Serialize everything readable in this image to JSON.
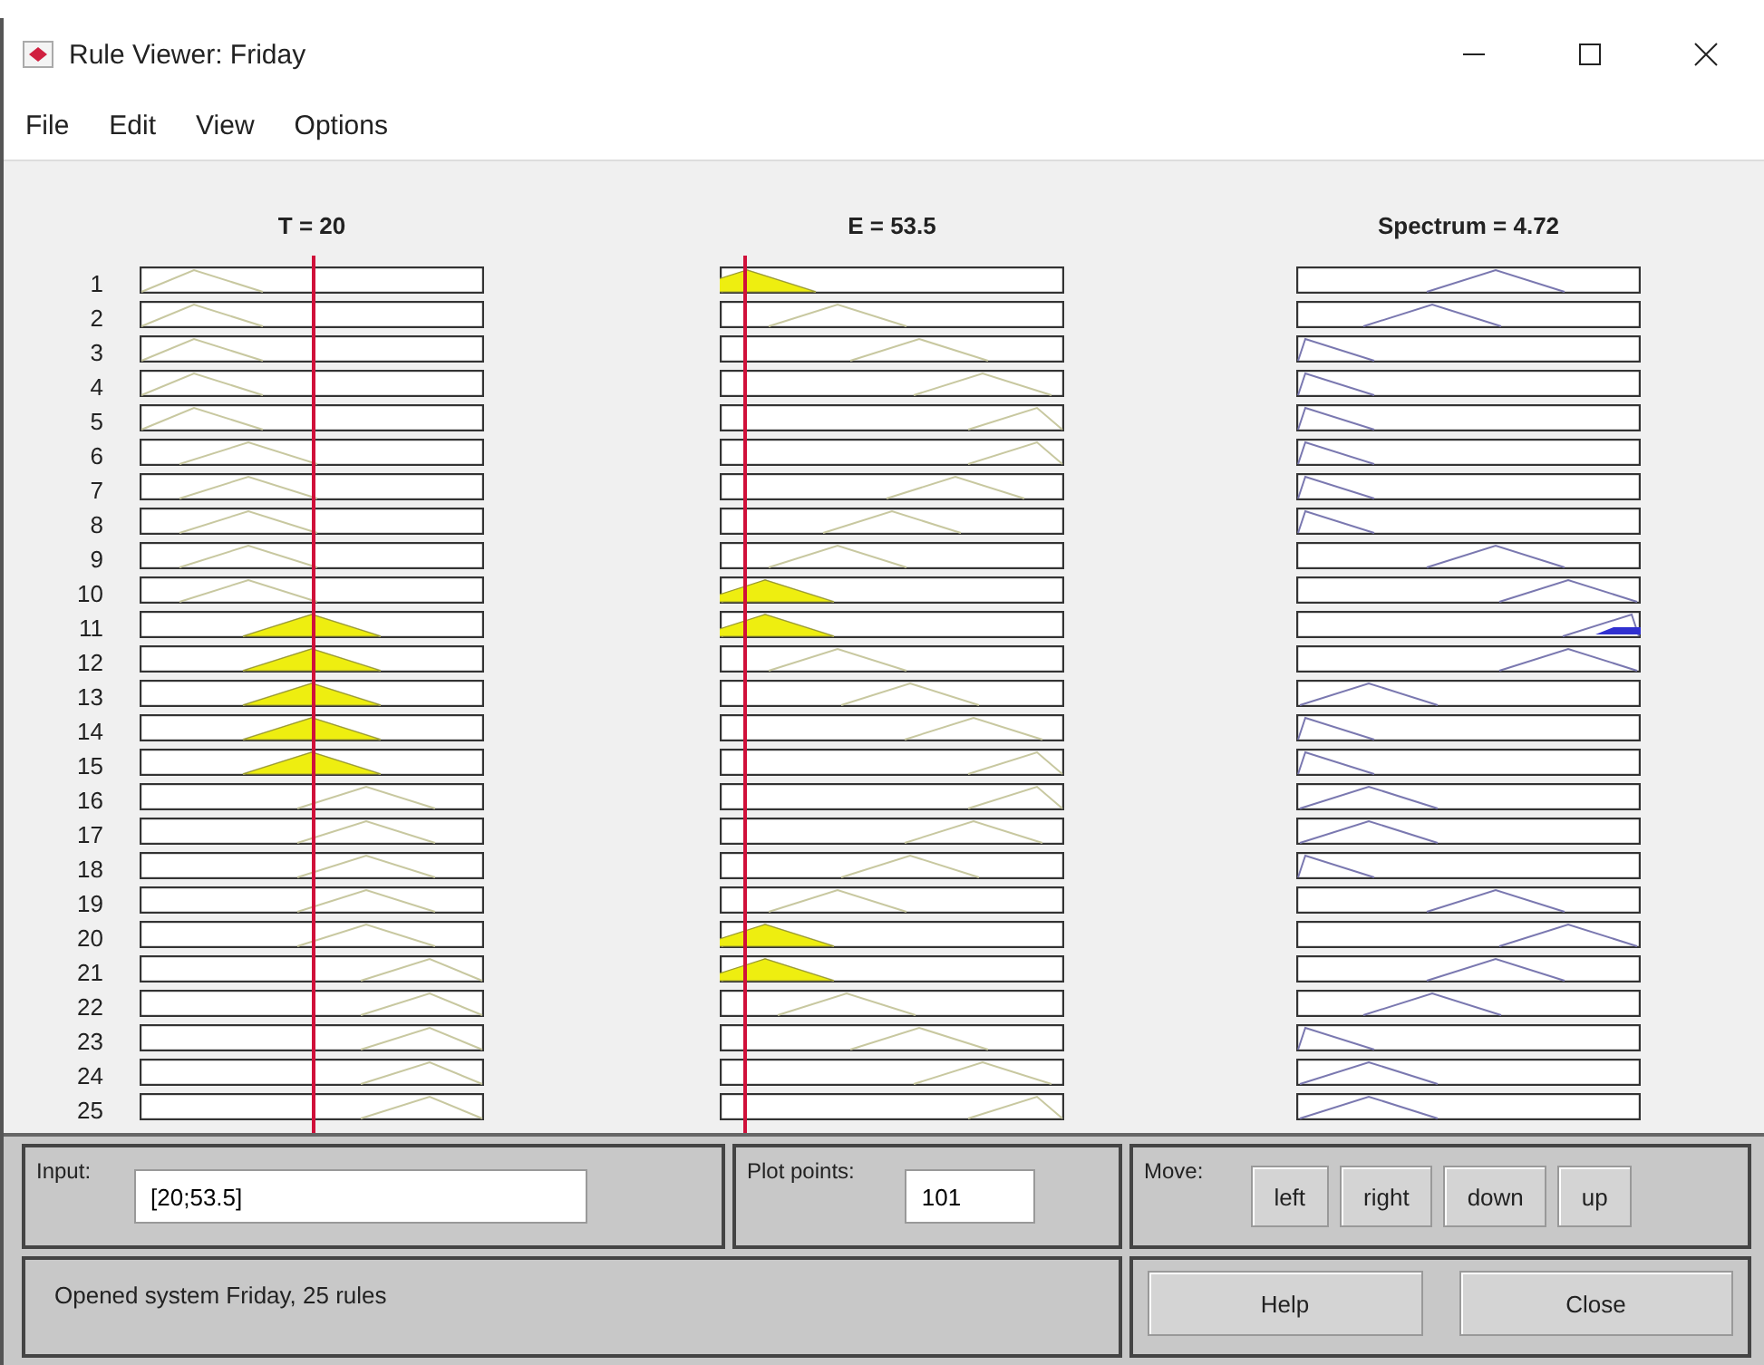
{
  "window": {
    "title": "Rule Viewer: Friday"
  },
  "menu": [
    "File",
    "Edit",
    "View",
    "Options"
  ],
  "variables": [
    {
      "label": "T = 20",
      "kind": "input"
    },
    {
      "label": "E = 53.5",
      "kind": "input"
    },
    {
      "label": "Spectrum = 4.72",
      "kind": "output"
    }
  ],
  "rules": [
    {
      "number": "1",
      "fired": [
        false,
        true,
        false
      ]
    },
    {
      "number": "2",
      "fired": [
        false,
        false,
        false
      ]
    },
    {
      "number": "3",
      "fired": [
        false,
        false,
        false
      ]
    },
    {
      "number": "4",
      "fired": [
        false,
        false,
        false
      ]
    },
    {
      "number": "5",
      "fired": [
        false,
        false,
        false
      ]
    },
    {
      "number": "6",
      "fired": [
        false,
        false,
        false
      ]
    },
    {
      "number": "7",
      "fired": [
        false,
        false,
        false
      ]
    },
    {
      "number": "8",
      "fired": [
        false,
        false,
        false
      ]
    },
    {
      "number": "9",
      "fired": [
        false,
        false,
        false
      ]
    },
    {
      "number": "10",
      "fired": [
        false,
        true,
        false
      ]
    },
    {
      "number": "11",
      "fired": [
        true,
        true,
        true
      ]
    },
    {
      "number": "12",
      "fired": [
        true,
        false,
        false
      ]
    },
    {
      "number": "13",
      "fired": [
        true,
        false,
        false
      ]
    },
    {
      "number": "14",
      "fired": [
        true,
        false,
        false
      ]
    },
    {
      "number": "15",
      "fired": [
        true,
        false,
        false
      ]
    },
    {
      "number": "16",
      "fired": [
        false,
        false,
        false
      ]
    },
    {
      "number": "17",
      "fired": [
        false,
        false,
        false
      ]
    },
    {
      "number": "18",
      "fired": [
        false,
        false,
        false
      ]
    },
    {
      "number": "19",
      "fired": [
        false,
        false,
        false
      ]
    },
    {
      "number": "20",
      "fired": [
        false,
        true,
        false
      ]
    },
    {
      "number": "21",
      "fired": [
        false,
        true,
        false
      ]
    },
    {
      "number": "22",
      "fired": [
        false,
        false,
        false
      ]
    },
    {
      "number": "23",
      "fired": [
        false,
        false,
        false
      ]
    },
    {
      "number": "24",
      "fired": [
        false,
        false,
        false
      ]
    },
    {
      "number": "25",
      "fired": [
        false,
        false,
        false
      ]
    }
  ],
  "input": {
    "label": "Input:",
    "value": "[20;53.5]"
  },
  "plot_points": {
    "label": "Plot points:",
    "value": "101"
  },
  "move": {
    "label": "Move:",
    "buttons": [
      "left",
      "right",
      "down",
      "up"
    ]
  },
  "status": "Opened system Friday, 25 rules",
  "buttons": [
    "Help",
    "Close"
  ]
}
